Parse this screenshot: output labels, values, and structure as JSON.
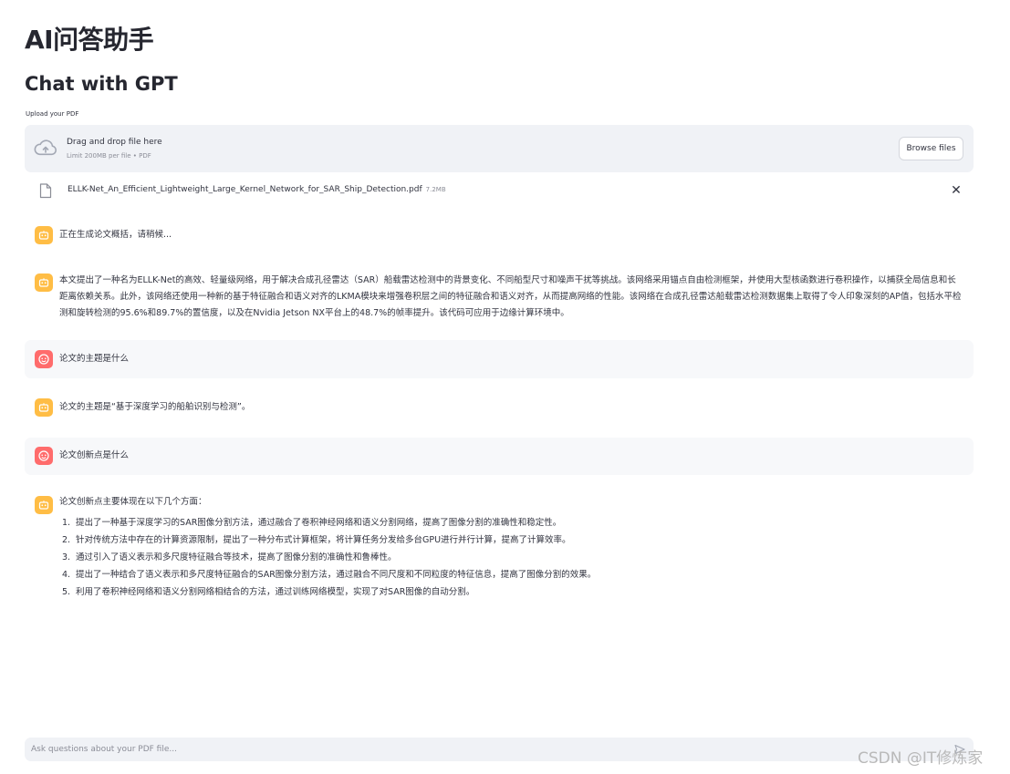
{
  "app": {
    "title": "AI问答助手",
    "subtitle": "Chat with GPT"
  },
  "uploader": {
    "label": "Upload your PDF",
    "drop_text": "Drag and drop file here",
    "limit_text": "Limit 200MB per file • PDF",
    "browse_label": "Browse files",
    "file": {
      "name": "ELLK-Net_An_Efficient_Lightweight_Large_Kernel_Network_for_SAR_Ship_Detection.pdf",
      "size": "7.2MB"
    }
  },
  "messages": [
    {
      "role": "assistant",
      "text": "正在生成论文概括，请稍候..."
    },
    {
      "role": "assistant",
      "text": "本文提出了一种名为ELLK-Net的高效、轻量级网络，用于解决合成孔径雷达（SAR）船载雷达检测中的背景变化、不同船型尺寸和噪声干扰等挑战。该网络采用锚点自由检测框架，并使用大型核函数进行卷积操作，以捕获全局信息和长距离依赖关系。此外，该网络还使用一种新的基于特征融合和语义对齐的LKMA模块来增强卷积层之间的特征融合和语义对齐，从而提高网络的性能。该网络在合成孔径雷达船载雷达检测数据集上取得了令人印象深刻的AP值，包括水平检测和旋转检测的95.6%和89.7%的置信度，以及在Nvidia Jetson NX平台上的48.7%的帧率提升。该代码可应用于边缘计算环境中。"
    },
    {
      "role": "user",
      "text": "论文的主题是什么"
    },
    {
      "role": "assistant",
      "text": "论文的主题是“基于深度学习的船舶识别与检测”。"
    },
    {
      "role": "user",
      "text": "论文创新点是什么"
    },
    {
      "role": "assistant",
      "text": "论文创新点主要体现在以下几个方面：",
      "items": [
        {
          "num": "1.",
          "text": "提出了一种基于深度学习的SAR图像分割方法，通过融合了卷积神经网络和语义分割网络，提高了图像分割的准确性和稳定性。"
        },
        {
          "num": "2.",
          "text": "针对传统方法中存在的计算资源限制，提出了一种分布式计算框架，将计算任务分发给多台GPU进行并行计算，提高了计算效率。"
        },
        {
          "num": "3.",
          "text": "通过引入了语义表示和多尺度特征融合等技术，提高了图像分割的准确性和鲁棒性。"
        },
        {
          "num": "4.",
          "text": "提出了一种结合了语义表示和多尺度特征融合的SAR图像分割方法，通过融合不同尺度和不同粒度的特征信息，提高了图像分割的效果。"
        },
        {
          "num": "5.",
          "text": "利用了卷积神经网络和语义分割网络相结合的方法，通过训练网络模型，实现了对SAR图像的自动分割。"
        }
      ]
    }
  ],
  "chat_input": {
    "placeholder": "Ask questions about your PDF file..."
  },
  "watermark": "CSDN @IT修炼家",
  "colors": {
    "assistant_avatar": "#ffbd45",
    "user_avatar": "#ff6c6c",
    "panel_bg": "#f0f2f6"
  }
}
